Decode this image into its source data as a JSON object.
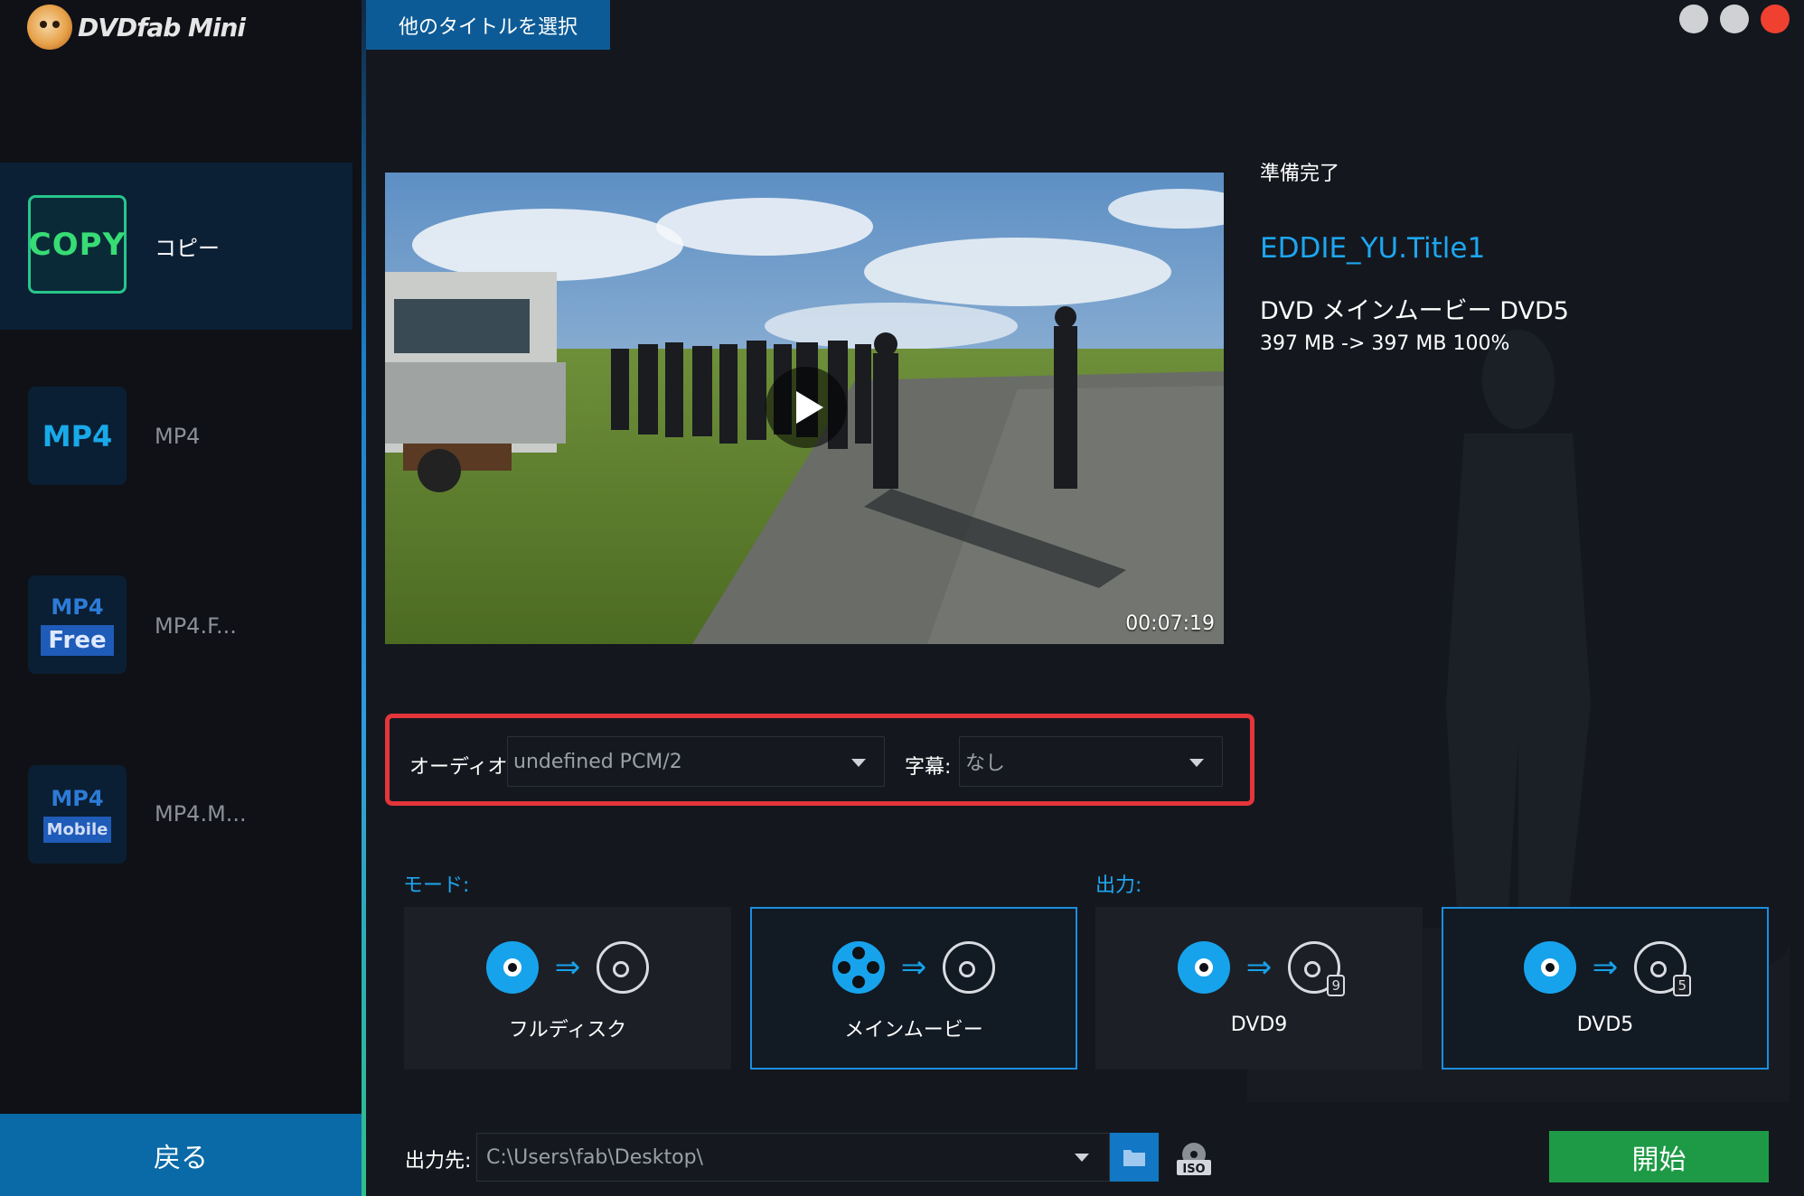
{
  "app": {
    "brand": "DVDfab Mini"
  },
  "sidebar": {
    "items": [
      {
        "badge": "COPY",
        "label": "コピー",
        "active": true
      },
      {
        "badge": "MP4",
        "label": "MP4",
        "active": false
      },
      {
        "badge_top": "MP4",
        "badge_tag": "Free",
        "label": "MP4.F...",
        "active": false
      },
      {
        "badge_top": "MP4",
        "badge_tag": "Mobile",
        "label": "MP4.M...",
        "active": false
      }
    ],
    "back_label": "戻る"
  },
  "toolbar": {
    "select_title_label": "他のタイトルを選択"
  },
  "window_controls": {
    "minimize_color": "#cfd1d4",
    "maximize_color": "#cfd1d4",
    "close_color": "#f04030"
  },
  "preview": {
    "duration": "00:07:19"
  },
  "info": {
    "status": "準備完了",
    "title_name": "EDDIE_YU.Title1",
    "description": "DVD メインムービー DVD5",
    "size": "397 MB -> 397 MB  100%"
  },
  "tracks": {
    "audio_label": "オーディオ:",
    "audio_value": "undefined PCM/2",
    "subtitle_label": "字幕:",
    "subtitle_value": "なし"
  },
  "mode": {
    "label": "モード:",
    "options": [
      {
        "label": "フルディスク",
        "icon": "disc-to-disc-icon",
        "selected": false
      },
      {
        "label": "メインムービー",
        "icon": "film-to-disc-icon",
        "selected": true
      }
    ]
  },
  "output": {
    "label": "出力:",
    "options": [
      {
        "label": "DVD9",
        "icon": "disc-to-dvd9-icon",
        "disc_number": "9",
        "selected": false
      },
      {
        "label": "DVD5",
        "icon": "disc-to-dvd5-icon",
        "disc_number": "5",
        "selected": true
      }
    ]
  },
  "destination": {
    "label": "出力先:",
    "path": "C:\\Users\\fab\\Desktop\\",
    "iso_label": "ISO"
  },
  "start_label": "開始",
  "colors": {
    "accent": "#1ea6f0",
    "highlight_border": "#e3353a",
    "start_green": "#1e9a46",
    "copy_green": "#37dc74"
  }
}
